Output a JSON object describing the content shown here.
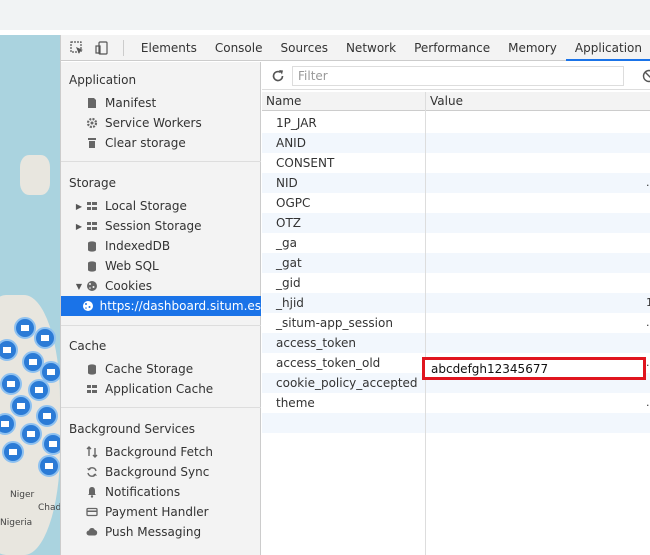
{
  "devtools": {
    "tabs": [
      "Elements",
      "Console",
      "Sources",
      "Network",
      "Performance",
      "Memory",
      "Application"
    ],
    "active_tab": "Application"
  },
  "sidebar": {
    "application": {
      "title": "Application",
      "items": [
        {
          "label": "Manifest",
          "icon": "manifest-icon"
        },
        {
          "label": "Service Workers",
          "icon": "gear-icon"
        },
        {
          "label": "Clear storage",
          "icon": "trash-icon"
        }
      ]
    },
    "storage": {
      "title": "Storage",
      "items": [
        {
          "label": "Local Storage",
          "icon": "grid-icon",
          "expandable": true
        },
        {
          "label": "Session Storage",
          "icon": "grid-icon",
          "expandable": true
        },
        {
          "label": "IndexedDB",
          "icon": "database-icon"
        },
        {
          "label": "Web SQL",
          "icon": "database-icon"
        },
        {
          "label": "Cookies",
          "icon": "cookie-icon",
          "expanded": true
        },
        {
          "label": "https://dashboard.situm.es",
          "icon": "cookie-icon",
          "selected": true
        }
      ]
    },
    "cache": {
      "title": "Cache",
      "items": [
        {
          "label": "Cache Storage",
          "icon": "database-icon"
        },
        {
          "label": "Application Cache",
          "icon": "grid-icon"
        }
      ]
    },
    "background": {
      "title": "Background Services",
      "items": [
        {
          "label": "Background Fetch",
          "icon": "fetch-icon"
        },
        {
          "label": "Background Sync",
          "icon": "sync-icon"
        },
        {
          "label": "Notifications",
          "icon": "bell-icon"
        },
        {
          "label": "Payment Handler",
          "icon": "card-icon"
        },
        {
          "label": "Push Messaging",
          "icon": "cloud-icon"
        }
      ]
    }
  },
  "filter": {
    "placeholder": "Filter"
  },
  "table": {
    "columns": [
      "Name",
      "Value"
    ],
    "rows": [
      {
        "name": "1P_JAR",
        "edge": ""
      },
      {
        "name": "ANID",
        "edge": ""
      },
      {
        "name": "CONSENT",
        "edge": ""
      },
      {
        "name": "NID",
        "edge": "."
      },
      {
        "name": "OGPC",
        "edge": ""
      },
      {
        "name": "OTZ",
        "edge": ""
      },
      {
        "name": "_ga",
        "edge": ""
      },
      {
        "name": "_gat",
        "edge": ""
      },
      {
        "name": "_gid",
        "edge": ""
      },
      {
        "name": "_hjid",
        "edge": "1"
      },
      {
        "name": "_situm-app_session",
        "edge": "."
      },
      {
        "name": "access_token",
        "edge": ""
      },
      {
        "name": "access_token_old",
        "edge": "."
      },
      {
        "name": "cookie_policy_accepted",
        "edge": ""
      },
      {
        "name": "theme",
        "edge": "."
      }
    ],
    "highlighted_value": "abcdefgh12345677"
  },
  "map": {
    "labels": [
      "Niger",
      "Chad",
      "Nigeria"
    ]
  },
  "colors": {
    "accent": "#1a73e8",
    "highlight_border": "#e0151f",
    "map_water": "#aad3df",
    "pin": "#2b7bd6"
  }
}
